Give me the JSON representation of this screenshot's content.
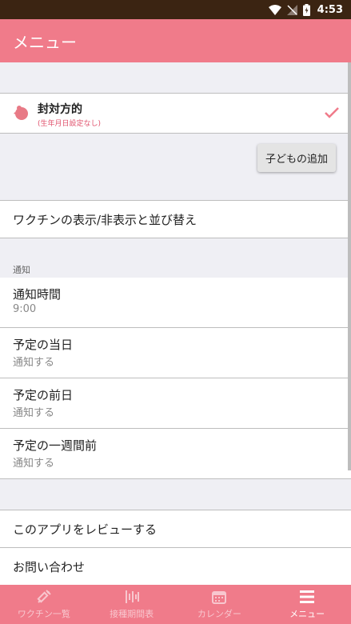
{
  "status": {
    "time": "4:53"
  },
  "header": {
    "title": "メニュー"
  },
  "child": {
    "name": "封対方的",
    "subtitle": "(生年月日設定なし)"
  },
  "add_child_button": "子どもの追加",
  "vaccine_row": "ワクチンの表示/非表示と並び替え",
  "notifications": {
    "section_label": "通知",
    "items": [
      {
        "title": "通知時間",
        "value": "9:00"
      },
      {
        "title": "予定の当日",
        "value": "通知する"
      },
      {
        "title": "予定の前日",
        "value": "通知する"
      },
      {
        "title": "予定の一週間前",
        "value": "通知する"
      }
    ]
  },
  "misc": {
    "review": "このアプリをレビューする",
    "contact": "お問い合わせ"
  },
  "nav": {
    "tabs": [
      {
        "label": "ワクチン一覧",
        "icon": "syringe-icon"
      },
      {
        "label": "接種期間表",
        "icon": "chart-icon"
      },
      {
        "label": "カレンダー",
        "icon": "calendar-icon"
      },
      {
        "label": "メニュー",
        "icon": "menu-icon"
      }
    ],
    "active": "メニュー"
  },
  "colors": {
    "accent": "#f07b8a",
    "status_bar": "#3b2412",
    "subtitle": "#e0506b"
  }
}
